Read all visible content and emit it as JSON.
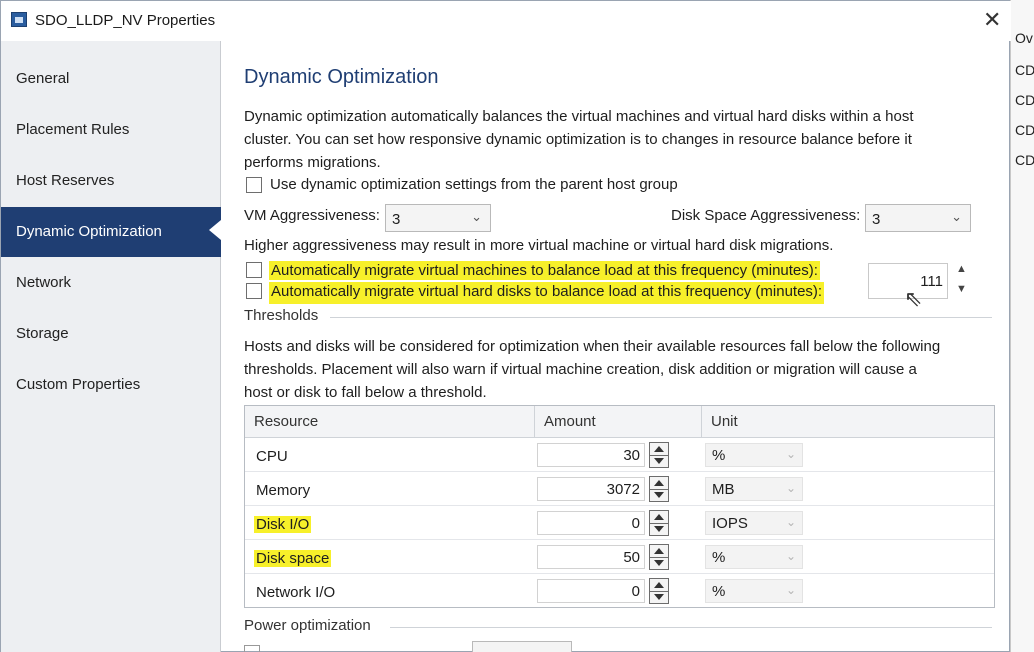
{
  "window": {
    "title": "SDO_LLDP_NV Properties",
    "close_glyph": "✕"
  },
  "background": {
    "column_header": "Ov",
    "rows": [
      "CD",
      "CD",
      "CD",
      "CD"
    ]
  },
  "sidebar": {
    "items": [
      {
        "label": "General"
      },
      {
        "label": "Placement Rules"
      },
      {
        "label": "Host Reserves"
      },
      {
        "label": "Dynamic Optimization",
        "active": true
      },
      {
        "label": "Network"
      },
      {
        "label": "Storage"
      },
      {
        "label": "Custom Properties"
      }
    ]
  },
  "main": {
    "heading": "Dynamic Optimization",
    "description_lines": [
      "Dynamic optimization automatically balances the virtual machines and virtual hard disks within a host",
      "cluster. You can set how responsive dynamic optimization is to changes in resource balance before it",
      "performs migrations."
    ],
    "use_parent_label": "Use dynamic optimization settings from the parent host group",
    "vm_aggressiveness": {
      "label": "VM Aggressiveness:",
      "value": "3"
    },
    "disk_aggressiveness": {
      "label": "Disk Space Aggressiveness:",
      "value": "3"
    },
    "aggressiveness_note": "Higher aggressiveness may result in more virtual machine or virtual hard disk migrations.",
    "migrate_vms_label": "Automatically migrate virtual machines to balance load at this frequency (minutes):",
    "migrate_disks_label": "Automatically migrate virtual hard disks to balance load at this frequency (minutes):",
    "frequency_value": "111",
    "thresholds": {
      "title": "Thresholds",
      "description_lines": [
        "Hosts and disks will be considered for optimization when their available resources fall below the following",
        "thresholds.  Placement will also warn if virtual machine creation, disk addition or migration will cause a",
        "host or disk to fall below a threshold."
      ],
      "columns": [
        "Resource",
        "Amount",
        "Unit"
      ],
      "rows": [
        {
          "resource": "CPU",
          "amount": "30",
          "unit": "%",
          "highlight": false
        },
        {
          "resource": "Memory",
          "amount": "3072",
          "unit": "MB",
          "highlight": false
        },
        {
          "resource": "Disk I/O",
          "amount": "0",
          "unit": "IOPS",
          "highlight": true
        },
        {
          "resource": "Disk space",
          "amount": "50",
          "unit": "%",
          "highlight": true
        },
        {
          "resource": "Network I/O",
          "amount": "0",
          "unit": "%",
          "highlight": false
        }
      ]
    },
    "power_optimization_title": "Power optimization"
  },
  "colors": {
    "accent": "#1f3e73",
    "highlight": "#f7f02a",
    "sidebar_bg": "#edeff2"
  }
}
